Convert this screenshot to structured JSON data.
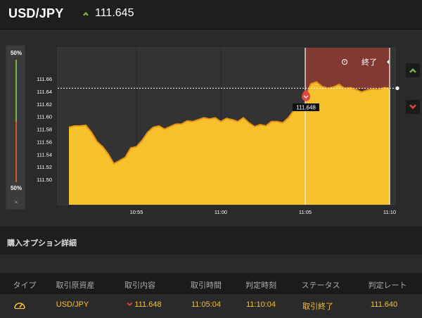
{
  "header": {
    "pair": "USD/JPY",
    "rate": "111.645",
    "rate_direction_icon": "chevron-up-icon",
    "up_color": "#7cb342"
  },
  "gauge": {
    "top_label": "50%",
    "bottom_label": "50%",
    "close_label": "×",
    "up_share": 0.5,
    "down_share": 0.5
  },
  "chart_data": {
    "type": "area",
    "series_color": "#f6c12d",
    "y_ticks": [
      "111.66",
      "111.64",
      "111.62",
      "111.60",
      "111.58",
      "111.56",
      "111.54",
      "111.52",
      "111.50"
    ],
    "x_ticks": [
      "10:55",
      "11:00",
      "11:05",
      "11:10"
    ],
    "ylim": [
      111.45,
      111.7
    ],
    "current_rate": 111.645,
    "entry_label": "111.648",
    "entry_time": "11:05",
    "end_time": "11:10",
    "expiry_panel_label": "終了",
    "expiry_panel_color": "#8a3a31",
    "direction": "down",
    "points": [
      [
        "10:51:00",
        111.583
      ],
      [
        "10:51:20",
        111.585
      ],
      [
        "10:51:40",
        111.585
      ],
      [
        "10:52:00",
        111.586
      ],
      [
        "10:52:20",
        111.575
      ],
      [
        "10:52:40",
        111.56
      ],
      [
        "10:53:00",
        111.552
      ],
      [
        "10:53:20",
        111.54
      ],
      [
        "10:53:40",
        111.525
      ],
      [
        "10:54:00",
        111.53
      ],
      [
        "10:54:20",
        111.535
      ],
      [
        "10:54:40",
        111.55
      ],
      [
        "10:55:00",
        111.552
      ],
      [
        "10:55:20",
        111.562
      ],
      [
        "10:55:40",
        111.575
      ],
      [
        "10:56:00",
        111.583
      ],
      [
        "10:56:20",
        111.585
      ],
      [
        "10:56:40",
        111.58
      ],
      [
        "10:57:00",
        111.584
      ],
      [
        "10:57:20",
        111.588
      ],
      [
        "10:57:40",
        111.588
      ],
      [
        "10:58:00",
        111.593
      ],
      [
        "10:58:20",
        111.592
      ],
      [
        "10:58:40",
        111.595
      ],
      [
        "10:59:00",
        111.598
      ],
      [
        "10:59:20",
        111.596
      ],
      [
        "10:59:40",
        111.598
      ],
      [
        "11:00:00",
        111.592
      ],
      [
        "11:00:20",
        111.597
      ],
      [
        "11:00:40",
        111.595
      ],
      [
        "11:01:00",
        111.592
      ],
      [
        "11:01:20",
        111.598
      ],
      [
        "11:01:40",
        111.59
      ],
      [
        "11:02:00",
        111.584
      ],
      [
        "11:02:20",
        111.587
      ],
      [
        "11:02:40",
        111.585
      ],
      [
        "11:03:00",
        111.592
      ],
      [
        "11:03:20",
        111.592
      ],
      [
        "11:03:40",
        111.59
      ],
      [
        "11:04:00",
        111.598
      ],
      [
        "11:04:20",
        111.61
      ],
      [
        "11:04:40",
        111.615
      ],
      [
        "11:05:00",
        111.62
      ],
      [
        "11:05:10",
        111.642
      ],
      [
        "11:05:20",
        111.652
      ],
      [
        "11:05:40",
        111.655
      ],
      [
        "11:06:00",
        111.648
      ],
      [
        "11:06:20",
        111.645
      ],
      [
        "11:06:40",
        111.647
      ],
      [
        "11:07:00",
        111.651
      ],
      [
        "11:07:20",
        111.645
      ],
      [
        "11:07:40",
        111.646
      ],
      [
        "11:08:00",
        111.643
      ],
      [
        "11:08:20",
        111.639
      ],
      [
        "11:08:40",
        111.642
      ],
      [
        "11:09:00",
        111.644
      ],
      [
        "11:09:20",
        111.643
      ],
      [
        "11:09:40",
        111.646
      ],
      [
        "11:10:00",
        111.645
      ]
    ]
  },
  "side_buttons": {
    "up_icon": "chevron-up-icon",
    "down_icon": "chevron-down-icon",
    "down_color": "#e2463c"
  },
  "details": {
    "section_title": "購入オプション詳細",
    "columns": [
      "タイプ",
      "取引原資産",
      "取引内容",
      "取引時間",
      "判定時刻",
      "ステータス",
      "判定レート"
    ],
    "row": {
      "type_icon": "timer-icon",
      "asset": "USD/JPY",
      "trade_direction_icon": "chevron-down-icon",
      "trade_rate": "111.648",
      "trade_time": "11:05:04",
      "judge_time": "11:10:04",
      "status": "取引終了",
      "judge_rate": "111.640"
    }
  }
}
